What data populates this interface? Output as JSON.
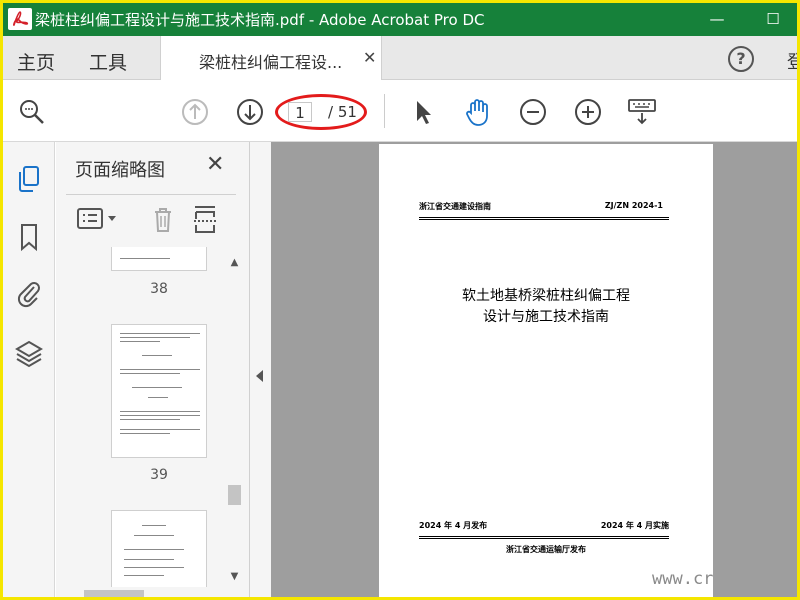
{
  "window": {
    "title": "梁桩柱纠偏工程设计与施工技术指南.pdf - Adobe Acrobat Pro DC",
    "minimize_glyph": "—",
    "maximize_glyph": "☐",
    "accent": "#16813a",
    "frame_color": "#f5e600"
  },
  "tabs": {
    "home": "主页",
    "tools": "工具",
    "doc": "梁桩柱纠偏工程设...",
    "close_glyph": "✕",
    "help_glyph": "?",
    "signin_clip": "登"
  },
  "toolbar": {
    "icons": [
      "find-icon",
      "prev-page-icon",
      "next-page-icon",
      "select-arrow-icon",
      "hand-tool-icon",
      "zoom-out-icon",
      "zoom-in-icon",
      "keyboard-icon"
    ],
    "current_page": "1",
    "total_pages": "/ 51",
    "highlight_color": "#e31b1b"
  },
  "panel": {
    "title": "页面缩略图",
    "close_glyph": "✕",
    "thumbnails": [
      {
        "label": "38"
      },
      {
        "label": "39"
      },
      {
        "label": ""
      }
    ]
  },
  "document": {
    "header_left": "浙江省交通建设指南",
    "header_right": "ZJ/ZN 2024-1",
    "title_line1": "软土地基桥梁桩柱纠偏工程",
    "title_line2": "设计与施工技术指南",
    "issue_date": "2024 年 4 月发布",
    "effective_date": "2024 年 4 月实施",
    "publisher": "浙江省交通运输厅发布"
  },
  "watermark": "www.cr"
}
